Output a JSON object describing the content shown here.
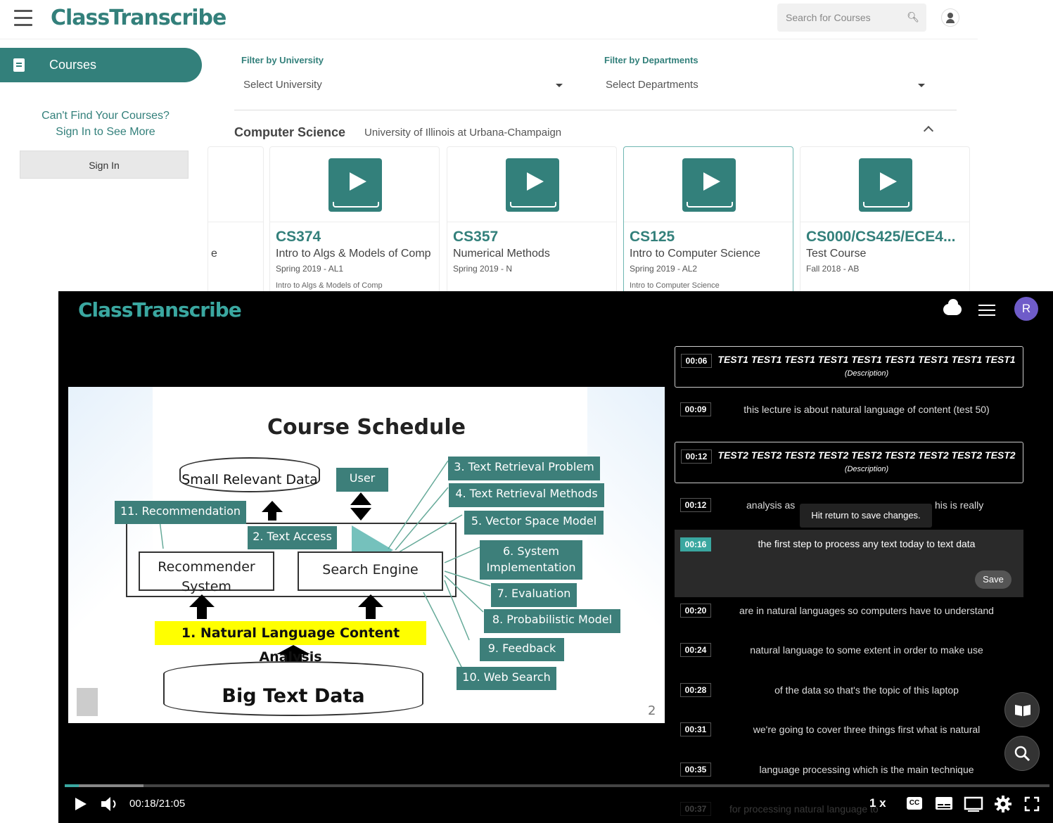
{
  "app": {
    "logo": "ClassTranscribe",
    "search_placeholder": "Search for Courses"
  },
  "sidebar": {
    "courses_label": "Courses",
    "cant_find_line1": "Can't Find Your Courses?",
    "cant_find_line2": "Sign In to See More",
    "signin_label": "Sign In"
  },
  "filters": {
    "university_label": "Filter by University",
    "university_value": "Select University",
    "departments_label": "Filter by Departments",
    "departments_value": "Select Departments"
  },
  "department": {
    "name": "Computer Science",
    "university": "University of Illinois at Urbana-Champaign",
    "partial_card_text": "e"
  },
  "courses": [
    {
      "code": "CS374",
      "name": "Intro to Algs & Models of Comp",
      "term": "Spring 2019 - AL1",
      "subtitle": "Intro to Algs & Models of Comp"
    },
    {
      "code": "CS357",
      "name": "Numerical Methods",
      "term": "Spring 2019 - N",
      "subtitle": ""
    },
    {
      "code": "CS125",
      "name": "Intro to Computer Science",
      "term": "Spring 2019 - AL2",
      "subtitle": "Intro to Computer Science"
    },
    {
      "code": "CS000/CS425/ECE4...",
      "name": "Test Course",
      "term": "Fall 2018 - AB",
      "subtitle": ""
    }
  ],
  "player": {
    "logo": "ClassTranscribe",
    "user_initial": "R",
    "time": "00:18/21:05",
    "speed": "1 x",
    "progress_fraction": 0.0143,
    "buffered_fraction": 0.08,
    "cc_label": "CC",
    "slide": {
      "title": "Course Schedule",
      "small_data": "Small Relevant Data",
      "user": "User",
      "recommendation": "11. Recommendation",
      "text_access": "2. Text Access",
      "recommender": "Recommender System",
      "search_engine": "Search Engine",
      "nlp": "1. Natural Language Content Analysis",
      "big_data": "Big Text Data",
      "topics": [
        "3. Text Retrieval Problem",
        "4. Text Retrieval Methods",
        "5. Vector Space Model",
        "6. System Implementation",
        "7. Evaluation",
        "8. Probabilistic Model",
        "9. Feedback",
        "10. Web Search"
      ],
      "page": "2"
    }
  },
  "transcript": {
    "tooltip": "Hit return to save changes.",
    "save_label": "Save",
    "lines": [
      {
        "time": "00:06",
        "text": "TEST1 TEST1 TEST1 TEST1 TEST1 TEST1 TEST1 TEST1 TEST1",
        "label": "(Description)"
      },
      {
        "time": "00:09",
        "text": "this lecture is about natural language of content (test 50)"
      },
      {
        "time": "00:12",
        "text": "TEST2 TEST2 TEST2 TEST2 TEST2 TEST2 TEST2 TEST2 TEST2",
        "label": "(Description)"
      },
      {
        "time": "00:12",
        "text": "analysis as",
        "text_end": "his is really"
      },
      {
        "time": "00:16",
        "text": "the first step to process any text today to text data"
      },
      {
        "time": "00:20",
        "text": "are in natural languages so computers have to understand"
      },
      {
        "time": "00:24",
        "text": "natural language to some extent in order to make use"
      },
      {
        "time": "00:28",
        "text": "of the data so that's the topic of this laptop"
      },
      {
        "time": "00:31",
        "text": "we're going to cover three things first what is natural"
      },
      {
        "time": "00:35",
        "text": "language processing which is the main technique"
      },
      {
        "time": "00:37",
        "text": "for processing natural language to"
      }
    ]
  },
  "colors": {
    "brand": "#33807b",
    "accent": "#3aa7a0",
    "avatar": "#6f5cc9"
  }
}
